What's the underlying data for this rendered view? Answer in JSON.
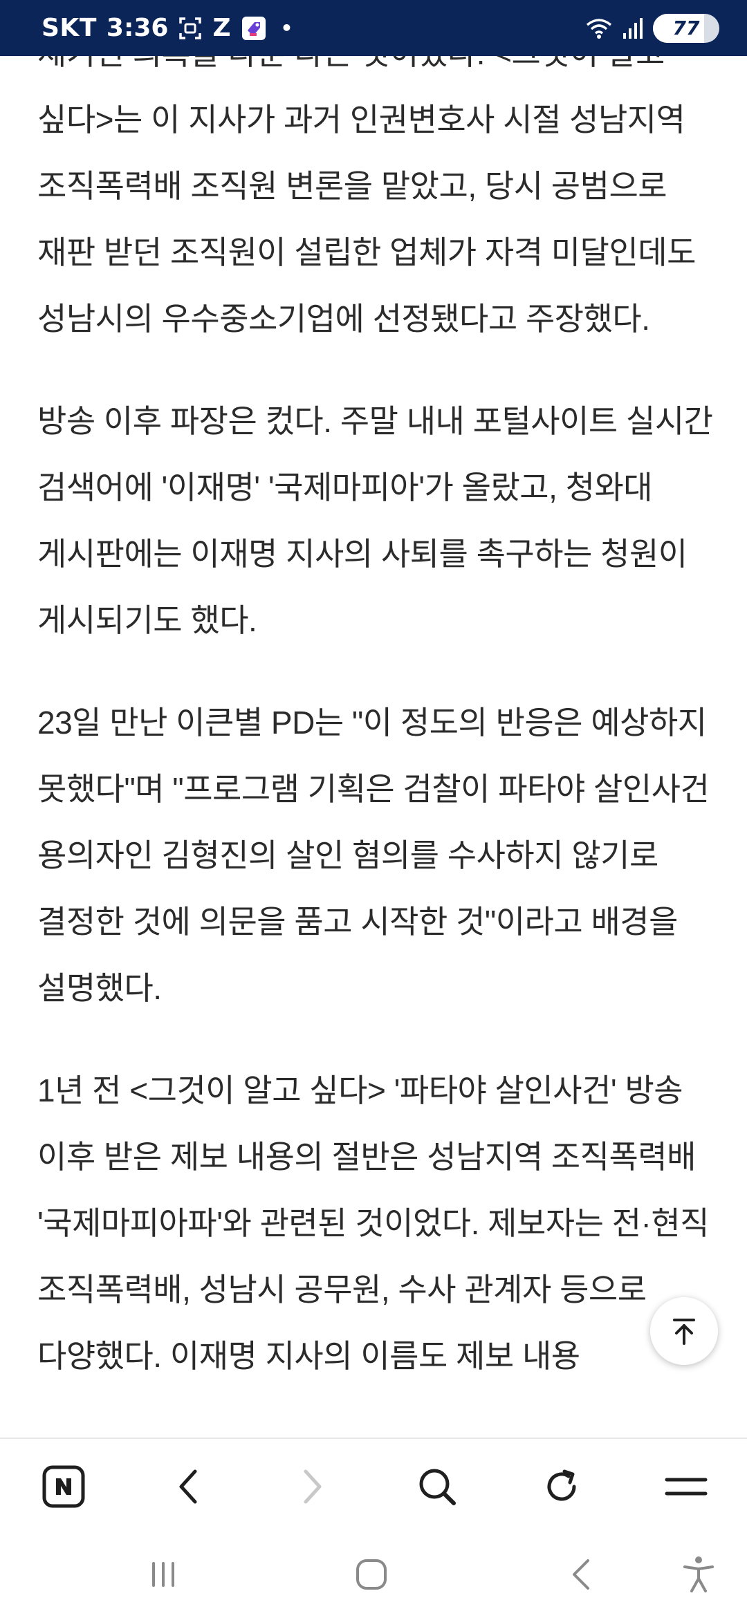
{
  "status_bar": {
    "carrier": "SKT",
    "time": "3:36",
    "app_icon_letter": "Z",
    "battery_level": "77",
    "icons": [
      "screenshot-icon",
      "z-app-icon",
      "tag-app-icon",
      "wifi-icon",
      "signal-icon",
      "battery-icon"
    ]
  },
  "article": {
    "paragraphs": [
      "제기된 의혹을 다룬 다는 것이었다. <그것이 알고 싶다>는 이 지사가 과거 인권변호사 시절 성남지역 조직폭력배 조직원 변론을 맡았고, 당시 공범으로 재판 받던 조직원이 설립한 업체가 자격 미달인데도 성남시의 우수중소기업에 선정됐다고 주장했다.",
      "방송 이후 파장은 컸다. 주말 내내 포털사이트 실시간 검색어에 '이재명' '국제마피아'가 올랐고, 청와대 게시판에는 이재명 지사의 사퇴를 촉구하는 청원이 게시되기도 했다.",
      "23일 만난 이큰별 PD는 \"이 정도의 반응은 예상하지 못했다\"며 \"프로그램 기획은 검찰이 파타야 살인사건 용의자인 김형진의 살인 혐의를 수사하지 않기로 결정한 것에 의문을 품고 시작한 것\"이라고 배경을 설명했다.",
      "1년 전 <그것이 알고 싶다> '파타야 살인사건' 방송 이후 받은 제보 내용의 절반은 성남지역 조직폭력배 '국제마피아파'와 관련된 것이었다. 제보자는 전·현직 조직폭력배, 성남시 공무원, 수사 관계자 등으로 다양했다. 이재명 지사의 이름도 제보 내용"
    ]
  },
  "scroll_top": {
    "icon": "arrow-up-icon"
  },
  "toolbar": {
    "items": [
      {
        "name": "naver-home-button",
        "icon": "naver-n-icon",
        "enabled": true
      },
      {
        "name": "back-button",
        "icon": "chevron-left-icon",
        "enabled": true
      },
      {
        "name": "forward-button",
        "icon": "chevron-right-icon",
        "enabled": false
      },
      {
        "name": "search-button",
        "icon": "search-icon",
        "enabled": true
      },
      {
        "name": "reload-button",
        "icon": "reload-icon",
        "enabled": true
      },
      {
        "name": "menu-button",
        "icon": "hamburger-icon",
        "enabled": true
      }
    ]
  },
  "system_nav": {
    "items": [
      "recent-apps-icon",
      "home-icon",
      "back-icon",
      "accessibility-icon"
    ]
  },
  "colors": {
    "status_bar_bg": "#0c2559",
    "text": "#2b2b2b",
    "toolbar_icon": "#1f1f1f",
    "toolbar_icon_disabled": "#c8c8c8",
    "system_icon": "#8a8a8a"
  }
}
